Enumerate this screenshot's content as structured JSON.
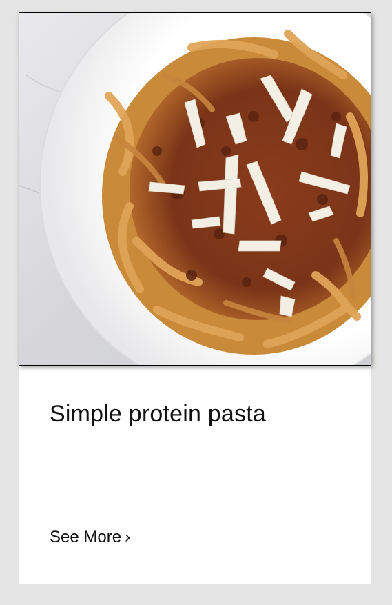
{
  "card": {
    "image": "pasta-bolognese-photo",
    "title": "Simple protein pasta",
    "link_label": "See More",
    "link_chevron": "›"
  },
  "colors": {
    "page_background": "#e4e4e4",
    "card_background": "#ffffff",
    "text": "#111111"
  }
}
